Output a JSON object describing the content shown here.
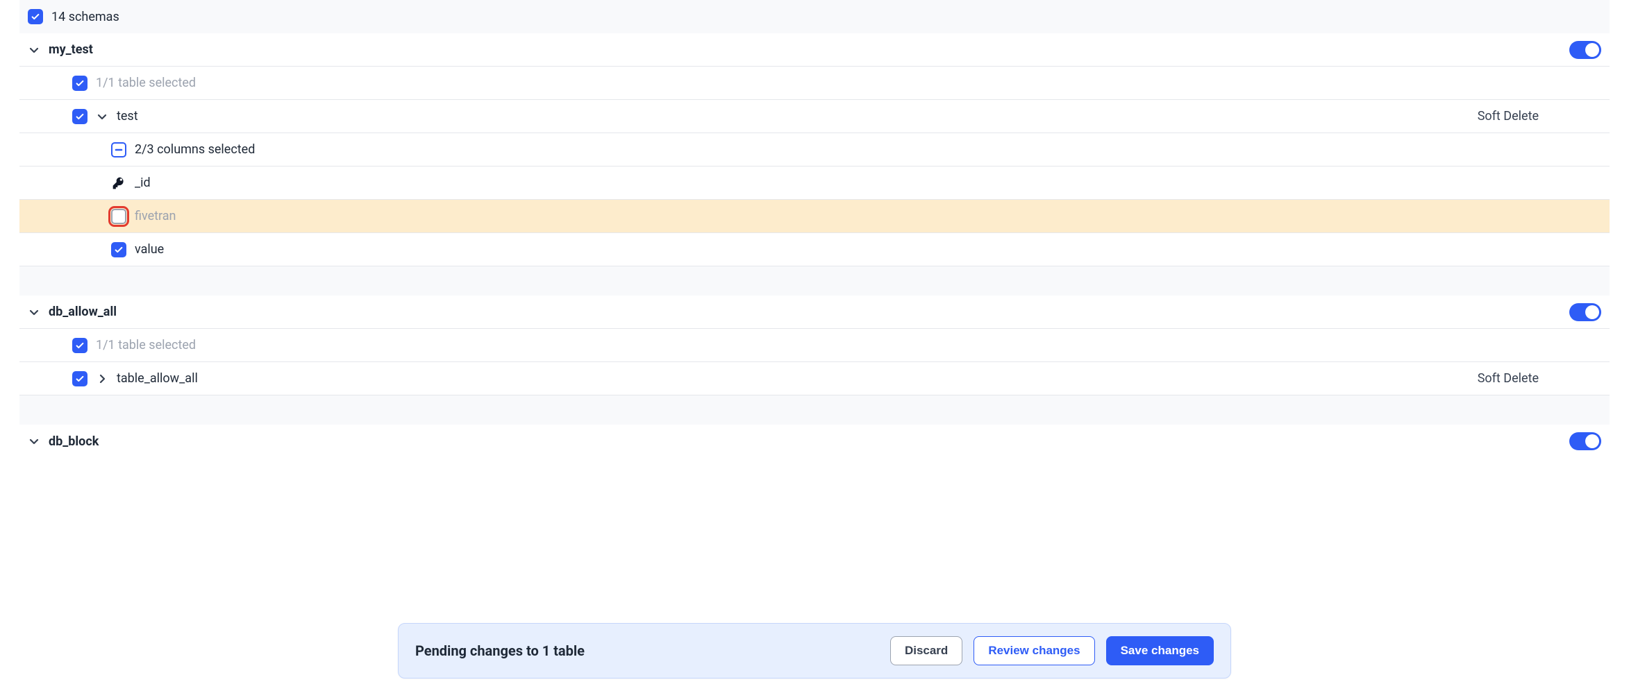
{
  "header": {
    "schemas_count_label": "14 schemas"
  },
  "schemas": {
    "my_test": {
      "name": "my_test",
      "tables_selected_label": "1/1 table selected",
      "table": {
        "name": "test",
        "sync_mode": "Soft Delete",
        "columns_selected_label": "2/3 columns selected",
        "columns": {
          "id": {
            "name": "_id"
          },
          "fivetran": {
            "name": "fivetran"
          },
          "value": {
            "name": "value"
          }
        }
      }
    },
    "db_allow_all": {
      "name": "db_allow_all",
      "tables_selected_label": "1/1 table selected",
      "table": {
        "name": "table_allow_all",
        "sync_mode": "Soft Delete"
      }
    },
    "db_block": {
      "name": "db_block"
    }
  },
  "pending": {
    "message": "Pending changes to 1 table",
    "discard": "Discard",
    "review": "Review changes",
    "save": "Save changes"
  }
}
